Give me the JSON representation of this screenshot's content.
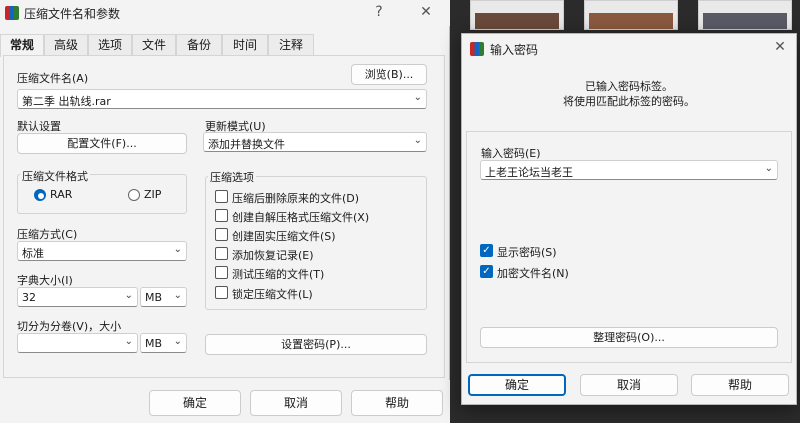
{
  "main_dialog": {
    "title": "压缩文件名和参数",
    "help_char": "?",
    "close_char": "✕",
    "tabs": [
      "常规",
      "高级",
      "选项",
      "文件",
      "备份",
      "时间",
      "注释"
    ],
    "archive_name_label": "压缩文件名(A)",
    "browse_label": "浏览(B)...",
    "archive_name_value": "第二季 出轨线.rar",
    "default_settings_label": "默认设置",
    "profiles_label": "配置文件(F)...",
    "update_mode_label": "更新模式(U)",
    "update_mode_value": "添加并替换文件",
    "archive_format": {
      "title": "压缩文件格式",
      "options": [
        "RAR",
        "ZIP"
      ],
      "selected": "RAR"
    },
    "method_label": "压缩方式(C)",
    "method_value": "标准",
    "dict_label": "字典大小(I)",
    "dict_value": "32",
    "dict_unit": "MB",
    "split_label": "切分为分卷(V)，大小",
    "split_value": "",
    "split_unit": "MB",
    "options_title": "压缩选项",
    "options": [
      {
        "label": "压缩后删除原来的文件(D)",
        "checked": false
      },
      {
        "label": "创建自解压格式压缩文件(X)",
        "checked": false
      },
      {
        "label": "创建固实压缩文件(S)",
        "checked": false
      },
      {
        "label": "添加恢复记录(E)",
        "checked": false
      },
      {
        "label": "测试压缩的文件(T)",
        "checked": false
      },
      {
        "label": "锁定压缩文件(L)",
        "checked": false
      }
    ],
    "set_password_label": "设置密码(P)...",
    "ok_label": "确定",
    "cancel_label": "取消",
    "help_label": "帮助"
  },
  "password_dialog": {
    "title": "输入密码",
    "close_char": "✕",
    "info_line1": "已输入密码标签。",
    "info_line2": "将使用匹配此标签的密码。",
    "enter_password_label": "输入密码(E)",
    "password_value": "上老王论坛当老王",
    "show_password_label": "显示密码(S)",
    "show_password_checked": true,
    "encrypt_names_label": "加密文件名(N)",
    "encrypt_names_checked": true,
    "organize_label": "整理密码(O)...",
    "ok_label": "确定",
    "cancel_label": "取消",
    "help_label": "帮助"
  },
  "icons": {
    "check": "✓",
    "chevron_down": "⌄"
  },
  "colors": {
    "accent": "#0067c0",
    "window_bg": "#f3f3f3"
  }
}
